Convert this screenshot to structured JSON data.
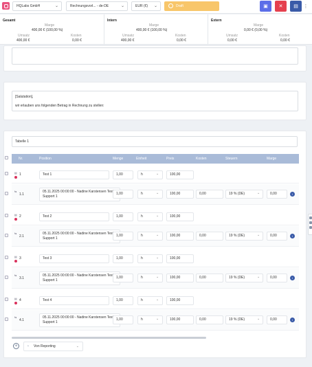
{
  "header": {
    "company": "HQLabs GmbH",
    "template": "Rechnungsvorl... - de-DE",
    "currency": "EUR (€)",
    "status": "Draft",
    "colors": {
      "save": "#5b6ee8",
      "cancel": "#e5404e",
      "comment": "#3a5ba8",
      "draft": "#f8c66a",
      "logo": "#e9537e"
    }
  },
  "summary": [
    {
      "title": "Gesamt",
      "marge_label": "Marge",
      "marge": "400,00 € (100,00 %)",
      "umsatz_label": "Umsatz",
      "umsatz": "400,00 €",
      "kosten_label": "Kosten",
      "kosten": "0,00 €"
    },
    {
      "title": "Intern",
      "marge_label": "Marge",
      "marge": "400,00 € (100,00 %)",
      "umsatz_label": "Umsatz",
      "umsatz": "400,00 €",
      "kosten_label": "Kosten",
      "kosten": "0,00 €"
    },
    {
      "title": "Extern",
      "marge_label": "Marge",
      "marge": "0,00 € (0,00 %)",
      "umsatz_label": "Umsatz",
      "umsatz": "0,00 €",
      "kosten_label": "Kosten",
      "kosten": "0,00 €"
    }
  ],
  "intro": {
    "line1": "[Salutation],",
    "line2": "wir erlauben uns folgenden Betrag in Rechnung zu stellen:"
  },
  "table": {
    "name": "Tabelle 1",
    "headers": {
      "nr": "Nr.",
      "position": "Position",
      "menge": "Menge",
      "einheit": "Einheit",
      "preis": "Preis",
      "kosten": "Kosten",
      "steuern": "Steuern",
      "marge": "Marge"
    },
    "rows": [
      {
        "nr": "1",
        "position": "Test 1",
        "menge": "1,00",
        "einheit": "h",
        "preis": "100,00"
      },
      {
        "nr": "1.1",
        "position": "05.11.2025 00:00:00 - Nadine Karstensen Test Support 1",
        "menge": "1,00",
        "einheit": "h",
        "preis": "100,00",
        "kosten": "0,00",
        "steuer": "19 % (DE)",
        "marge": "0,00"
      },
      {
        "nr": "2",
        "position": "Test 2",
        "menge": "1,00",
        "einheit": "h",
        "preis": "100,00"
      },
      {
        "nr": "2.1",
        "position": "05.11.2025 00:00:00 - Nadine Karstensen Test Support 1",
        "menge": "1,00",
        "einheit": "h",
        "preis": "100,00",
        "kosten": "0,00",
        "steuer": "19 % (DE)",
        "marge": "0,00"
      },
      {
        "nr": "3",
        "position": "Test 3",
        "menge": "1,00",
        "einheit": "h",
        "preis": "100,00"
      },
      {
        "nr": "3.1",
        "position": "05.11.2025 00:00:00 - Nadine Karstensen Test Support 1",
        "menge": "1,00",
        "einheit": "h",
        "preis": "100,00",
        "kosten": "0,00",
        "steuer": "19 % (DE)",
        "marge": "0,00"
      },
      {
        "nr": "4",
        "position": "Test 4",
        "menge": "1,00",
        "einheit": "h",
        "preis": "100,00"
      },
      {
        "nr": "4.1",
        "position": "05.11.2025 00:00:00 - Nadine Karstensen Test Support 1",
        "menge": "1,00",
        "einheit": "h",
        "preis": "100,00",
        "kosten": "0,00",
        "steuer": "19 % (DE)",
        "marge": "0,00"
      }
    ]
  },
  "footer": {
    "add_source": "Von Reporting"
  }
}
